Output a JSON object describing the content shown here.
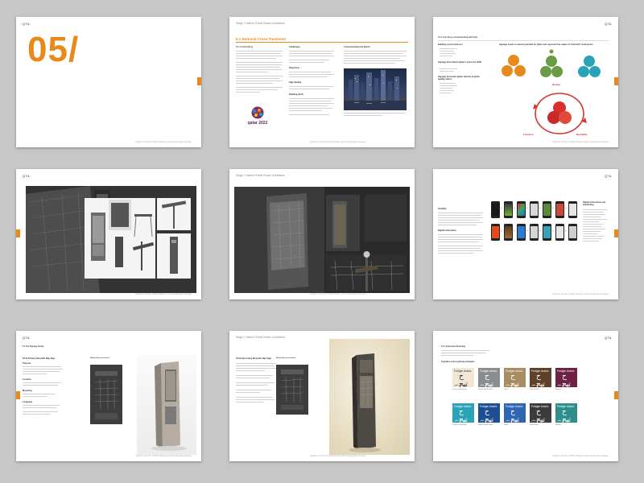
{
  "header": {
    "logo": "QTA",
    "guideline_title": "Stage 2 Interim Public Realm Guidelines",
    "footer": "Qatar's Interim Public Realm and Landscape Design"
  },
  "page1": {
    "chapter_number": "05/"
  },
  "page2": {
    "section_title": "5.1 National Cross Treatment",
    "sub_left": "5.1.1 Cover Story",
    "challenges_label": "Challenges",
    "objectives_label": "Objectives",
    "high_quality_label": "High Quality",
    "building_block_label": "Building block",
    "communicating_label": "Communicating the Brand",
    "logo_text": "qatar 2022"
  },
  "page3": {
    "section_title": "5.1.2 Your Story, Communicating with Style",
    "diagram_title": "Signage needs to unlock potential for Qatar and represent the values of 'Inherited' touchpoints",
    "labels": {
      "beauty": "Beauty",
      "function": "Function",
      "durability": "Durability"
    },
    "left_heading_1": "Building social cohesion",
    "left_heading_2": "Signage that reflects Qatar's vision for 2030",
    "left_heading_3": "Signage that leads Qatari identity & Qatari quality values"
  },
  "page6": {
    "heading_1": "Visibility",
    "heading_2": "Digital information",
    "right_title": "Digital information and wayfinding"
  },
  "page7": {
    "section_title": "5.4 The Signage Family",
    "item_title": "ST1a Primary Monolith Map Sign",
    "purpose_label": "Purpose",
    "location_label": "Location",
    "mounting_label": "Mounting",
    "language_label": "Language",
    "sub_caption": "Wayfinding information"
  },
  "page8": {
    "item_title": "ST1b Secondary Monolith Map Sign",
    "sub_caption": "Wayfinding information"
  },
  "page9": {
    "section_title": "5.4.1 Pedestrian Bounding",
    "examples_label": "Typeface colour pairing examples",
    "swatches": [
      {
        "font": "Frutiger Arabic",
        "glyph": "ح تيح",
        "sub": "أبجد هوز حطي",
        "caption": "Colour of Heritage",
        "color": "#f2e6d4",
        "text": "#333333"
      },
      {
        "font": "Frutiger Arabic",
        "glyph": "ح تيح",
        "sub": "أبجد هوز حطي",
        "caption": "Mixed Wood Sand",
        "color": "#8a8d90",
        "text": "#ffffff"
      },
      {
        "font": "Frutiger Arabic",
        "glyph": "ح تيح",
        "sub": "أبجد هوز حطي",
        "caption": "Sand",
        "color": "#a88c62",
        "text": "#ffffff"
      },
      {
        "font": "Frutiger Arabic",
        "glyph": "ح تيح",
        "sub": "أبجد هوز حطي",
        "caption": "Dark Sand",
        "color": "#5e4127",
        "text": "#ffffff"
      },
      {
        "font": "Frutiger Arabic",
        "glyph": "ح تيح",
        "sub": "أبجد هوز حطي",
        "caption": "Maroon",
        "color": "#6c2145",
        "text": "#ffffff"
      },
      {
        "font": "Frutiger Arabic",
        "glyph": "ح تيح",
        "sub": "أبجد هوز حطي",
        "caption": "Colour of Heritage",
        "color": "#2aa3b8",
        "text": "#ffffff"
      },
      {
        "font": "Frutiger Arabic",
        "glyph": "ح تيح",
        "sub": "أبجد هوز حطي",
        "caption": "Mixed Wood Sand",
        "color": "#1d4e93",
        "text": "#ffffff"
      },
      {
        "font": "Frutiger Arabic",
        "glyph": "ح تيح",
        "sub": "أبجد هوز حطي",
        "caption": "Sand",
        "color": "#2f66b3",
        "text": "#ffffff"
      },
      {
        "font": "Frutiger Arabic",
        "glyph": "ح تيح",
        "sub": "أبجد هوز حطي",
        "caption": "Dark Sand",
        "color": "#3b3b3b",
        "text": "#ffffff"
      },
      {
        "font": "Frutiger Arabic",
        "glyph": "ح تيح",
        "sub": "أبجد هوز حطي",
        "caption": "Maroon",
        "color": "#2e8f8a",
        "text": "#ffffff"
      }
    ]
  },
  "colors": {
    "accent": "#e8891c",
    "cycle_red": "#d9302c",
    "background": "#c7c7c7"
  }
}
